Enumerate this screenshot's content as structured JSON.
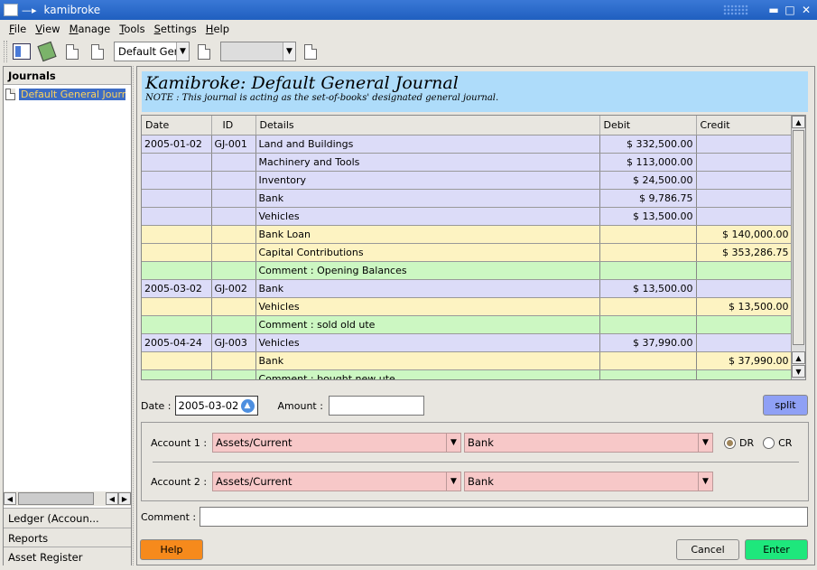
{
  "window": {
    "title": "kamibroke"
  },
  "menu": [
    {
      "label": "File",
      "accel": "F",
      "rest": "ile"
    },
    {
      "label": "View",
      "accel": "V",
      "rest": "iew"
    },
    {
      "label": "Manage",
      "accel": "M",
      "rest": "anage"
    },
    {
      "label": "Tools",
      "accel": "T",
      "rest": "ools"
    },
    {
      "label": "Settings",
      "accel": "S",
      "rest": "ettings"
    },
    {
      "label": "Help",
      "accel": "H",
      "rest": "elp"
    }
  ],
  "toolbar": {
    "journal_combo": "Default Ger",
    "second_combo": ""
  },
  "left_panel": {
    "header": "Journals",
    "items": [
      "Default General Journal"
    ],
    "tabs": [
      "Ledger (Accoun...",
      "Reports",
      "Asset Register"
    ]
  },
  "journal": {
    "title": "Kamibroke: Default General Journal",
    "note": "NOTE : This journal is acting as the set-of-books' designated general journal."
  },
  "grid": {
    "columns": [
      "Date",
      "ID",
      "Details",
      "Debit",
      "Credit"
    ],
    "rows": [
      {
        "type": "debit",
        "date": "2005-01-02",
        "id": "GJ-001",
        "details": "Land and Buildings",
        "debit": "$ 332,500.00",
        "credit": ""
      },
      {
        "type": "debit",
        "date": "",
        "id": "",
        "details": "Machinery and Tools",
        "debit": "$ 113,000.00",
        "credit": ""
      },
      {
        "type": "debit",
        "date": "",
        "id": "",
        "details": "Inventory",
        "debit": "$ 24,500.00",
        "credit": ""
      },
      {
        "type": "debit",
        "date": "",
        "id": "",
        "details": "Bank",
        "debit": "$ 9,786.75",
        "credit": ""
      },
      {
        "type": "debit",
        "date": "",
        "id": "",
        "details": "Vehicles",
        "debit": "$ 13,500.00",
        "credit": ""
      },
      {
        "type": "credit",
        "date": "",
        "id": "",
        "details": "Bank Loan",
        "debit": "",
        "credit": "$ 140,000.00"
      },
      {
        "type": "credit",
        "date": "",
        "id": "",
        "details": "Capital Contributions",
        "debit": "",
        "credit": "$ 353,286.75"
      },
      {
        "type": "comment",
        "date": "",
        "id": "",
        "details": "Comment : Opening Balances",
        "debit": "",
        "credit": ""
      },
      {
        "type": "debit",
        "date": "2005-03-02",
        "id": "GJ-002",
        "details": "Bank",
        "debit": "$ 13,500.00",
        "credit": ""
      },
      {
        "type": "credit",
        "date": "",
        "id": "",
        "details": "Vehicles",
        "debit": "",
        "credit": "$ 13,500.00"
      },
      {
        "type": "comment",
        "date": "",
        "id": "",
        "details": "Comment : sold old ute",
        "debit": "",
        "credit": ""
      },
      {
        "type": "debit",
        "date": "2005-04-24",
        "id": "GJ-003",
        "details": "Vehicles",
        "debit": "$ 37,990.00",
        "credit": ""
      },
      {
        "type": "credit",
        "date": "",
        "id": "",
        "details": "Bank",
        "debit": "",
        "credit": "$ 37,990.00"
      },
      {
        "type": "comment",
        "date": "",
        "id": "",
        "details": "Comment : bought new ute",
        "debit": "",
        "credit": ""
      }
    ]
  },
  "form": {
    "date_label": "Date :",
    "date_value": "2005-03-02",
    "amount_label": "Amount :",
    "amount_value": "",
    "split_label": "split",
    "account1_label": "Account 1 :",
    "account1_group": "Assets/Current",
    "account1_account": "Bank",
    "account2_label": "Account 2 :",
    "account2_group": "Assets/Current",
    "account2_account": "Bank",
    "dr_label": "DR",
    "cr_label": "CR",
    "comment_label": "Comment :",
    "comment_value": "",
    "help_label": "Help",
    "cancel_label": "Cancel",
    "enter_label": "Enter"
  },
  "colors": {
    "title_bar": "#1f5fbf",
    "debit_row": "#dcdcf8",
    "credit_row": "#fdf3c2",
    "comment_row": "#ccf7c2",
    "header_bg": "#aedcfa",
    "account_combo": "#f7c8c8",
    "split_button": "#8fa0f5",
    "help_button": "#f68a1c",
    "enter_button": "#1ee77c"
  }
}
